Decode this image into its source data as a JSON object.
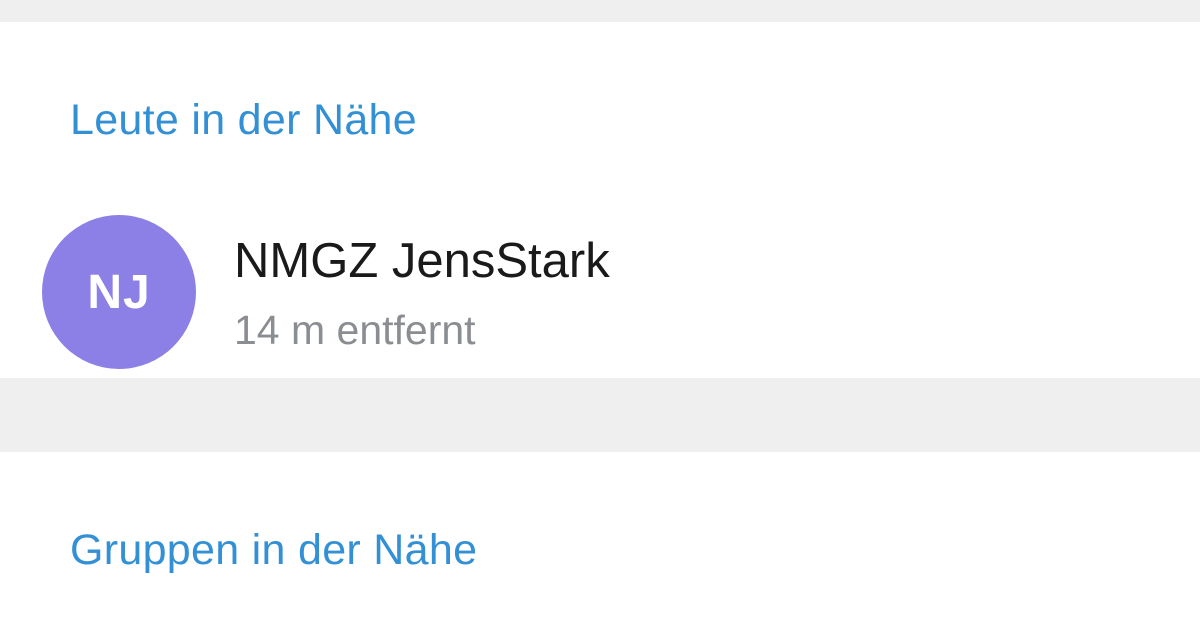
{
  "people_nearby": {
    "header": "Leute in der Nähe",
    "items": [
      {
        "avatar_initials": "NJ",
        "name": "NMGZ JensStark",
        "distance": "14 m entfernt",
        "avatar_color": "#8c7fe6"
      }
    ]
  },
  "groups_nearby": {
    "header": "Gruppen in der Nähe"
  },
  "colors": {
    "accent": "#3390d4",
    "background": "#efefef",
    "section_background": "#ffffff",
    "secondary_text": "#8a8d91"
  }
}
